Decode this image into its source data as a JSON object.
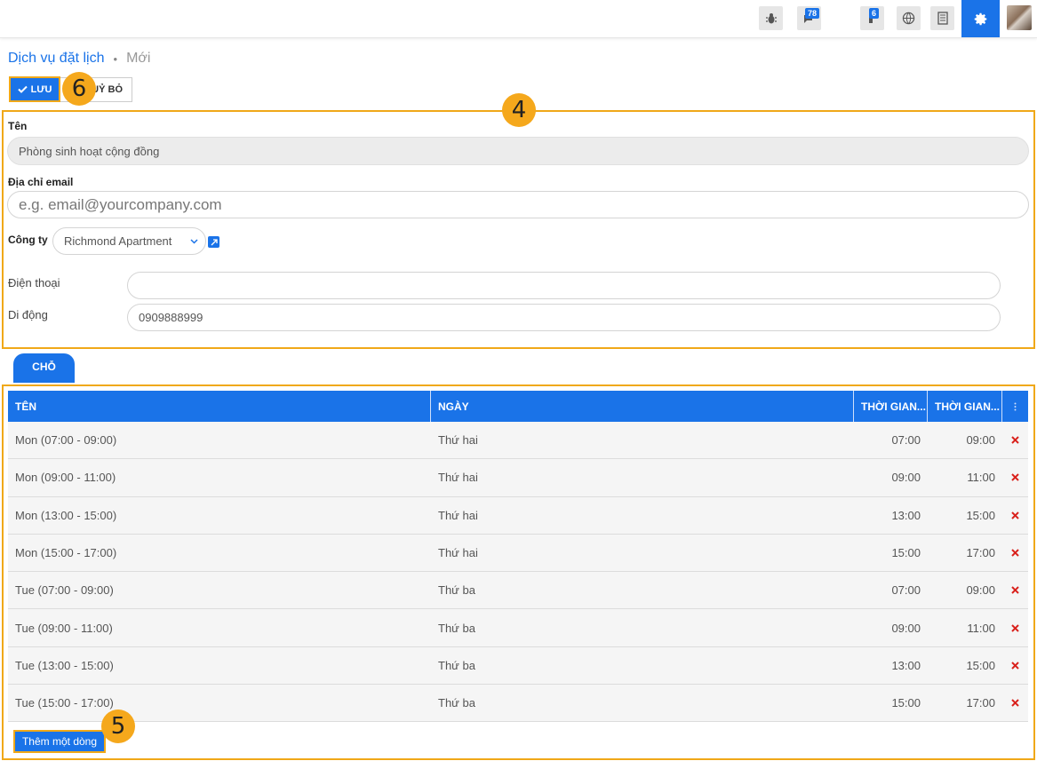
{
  "topbar": {
    "icons": [
      "bug-icon",
      "chat-icon",
      "activity-icon",
      "globe-icon",
      "document-icon",
      "gear-icon",
      "avatar"
    ],
    "chat_badge": "78",
    "activity_badge": "6"
  },
  "breadcrumb": {
    "parent": "Dịch vụ đặt lịch",
    "separator": "•",
    "current": "Mới"
  },
  "toolbar": {
    "save_label": "LƯU",
    "discard_label": "HUỶ BỎ"
  },
  "callouts": {
    "c4": "4",
    "c5": "5",
    "c6": "6"
  },
  "form": {
    "name_label": "Tên",
    "name_value": "Phòng sinh hoạt cộng đồng",
    "email_label": "Địa chỉ email",
    "email_placeholder": "e.g. email@yourcompany.com",
    "company_label": "Công ty",
    "company_value": "Richmond Apartment",
    "phone_label": "Điện thoại",
    "phone_value": "",
    "mobile_label": "Di động",
    "mobile_value": "0909888999"
  },
  "tab": {
    "label": "CHỖ"
  },
  "table": {
    "headers": [
      "TÊN",
      "NGÀY",
      "THỜI GIAN...",
      "THỜI GIAN..."
    ],
    "rows": [
      {
        "name": "Mon (07:00 - 09:00)",
        "day": "Thứ hai",
        "start": "07:00",
        "end": "09:00"
      },
      {
        "name": "Mon (09:00 - 11:00)",
        "day": "Thứ hai",
        "start": "09:00",
        "end": "11:00"
      },
      {
        "name": "Mon (13:00 - 15:00)",
        "day": "Thứ hai",
        "start": "13:00",
        "end": "15:00"
      },
      {
        "name": "Mon (15:00 - 17:00)",
        "day": "Thứ hai",
        "start": "15:00",
        "end": "17:00"
      },
      {
        "name": "Tue (07:00 - 09:00)",
        "day": "Thứ ba",
        "start": "07:00",
        "end": "09:00"
      },
      {
        "name": "Tue (09:00 - 11:00)",
        "day": "Thứ ba",
        "start": "09:00",
        "end": "11:00"
      },
      {
        "name": "Tue (13:00 - 15:00)",
        "day": "Thứ ba",
        "start": "13:00",
        "end": "15:00"
      },
      {
        "name": "Tue (15:00 - 17:00)",
        "day": "Thứ ba",
        "start": "15:00",
        "end": "17:00"
      }
    ],
    "add_line_label": "Thêm một dòng"
  },
  "colors": {
    "primary": "#1a73e8",
    "highlight": "#f0a818",
    "delete": "#d9211c"
  }
}
